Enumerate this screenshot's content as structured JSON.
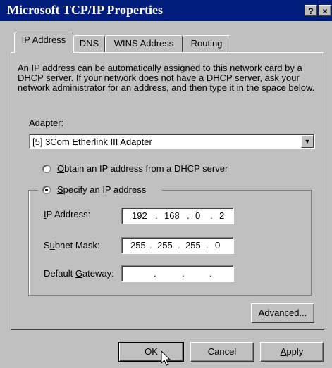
{
  "window": {
    "title": "Microsoft TCP/IP Properties",
    "help_button": "?",
    "close_button": "×"
  },
  "tabs": [
    {
      "label": "IP Address",
      "active": true
    },
    {
      "label": "DNS",
      "active": false
    },
    {
      "label": "WINS Address",
      "active": false
    },
    {
      "label": "Routing",
      "active": false
    }
  ],
  "description": "An IP address can be automatically assigned to this network card by a DHCP server.  If your network does not have a DHCP server, ask your network administrator for an address, and then type it in the space below.",
  "adapter": {
    "label_pre": "Ada",
    "label_u": "p",
    "label_post": "ter:",
    "selected": "[5] 3Com Etherlink III Adapter",
    "dropdown_icon": "chevron-down-icon"
  },
  "radio_dhcp": {
    "label_u": "O",
    "label_post": "btain an IP address from a DHCP server",
    "checked": false
  },
  "radio_specify": {
    "label_u": "S",
    "label_post": "pecify an IP address",
    "checked": true
  },
  "fields": {
    "ip": {
      "label_u": "I",
      "label_post": "P Address:",
      "octets": [
        "192",
        "168",
        "0",
        "2"
      ]
    },
    "subnet": {
      "label_pre": "S",
      "label_u": "u",
      "label_post": "bnet Mask:",
      "octets": [
        "255",
        "255",
        "255",
        "0"
      ]
    },
    "gateway": {
      "label_pre": "Default ",
      "label_u": "G",
      "label_post": "ateway:",
      "octets": [
        "",
        "",
        "",
        ""
      ]
    }
  },
  "buttons": {
    "advanced_pre": "A",
    "advanced_u": "d",
    "advanced_post": "vanced...",
    "ok": "OK",
    "cancel": "Cancel",
    "apply_u": "A",
    "apply_post": "pply"
  }
}
